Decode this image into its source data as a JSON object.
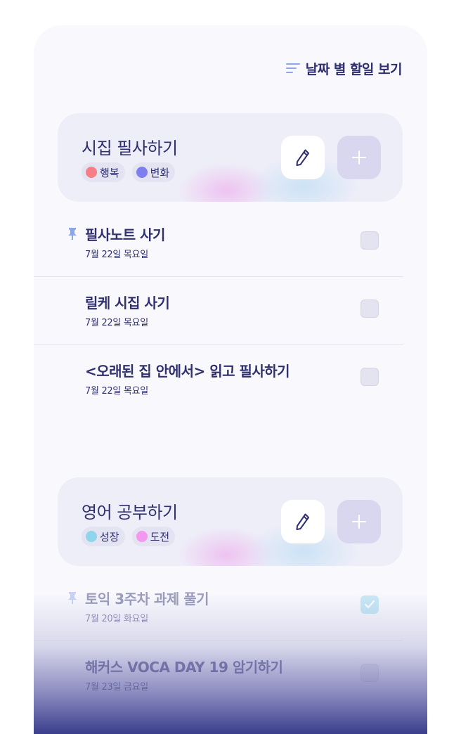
{
  "header": {
    "view_by_date_label": "날짜 별 할일 보기"
  },
  "groups": [
    {
      "title": "시집 필사하기",
      "tags": [
        {
          "label": "행복",
          "color": "#f47f86"
        },
        {
          "label": "변화",
          "color": "#7e7ef0"
        }
      ],
      "tasks": [
        {
          "title": "필사노트 사기",
          "date": "7월 22일 목요일",
          "pinned": true,
          "checked": false
        },
        {
          "title": "릴케 시집 사기",
          "date": "7월 22일 목요일",
          "pinned": false,
          "checked": false
        },
        {
          "title": "<오래된 집 안에서> 읽고 필사하기",
          "date": "7월 22일 목요일",
          "pinned": false,
          "checked": false
        }
      ]
    },
    {
      "title": "영어 공부하기",
      "tags": [
        {
          "label": "성장",
          "color": "#8fd6ec"
        },
        {
          "label": "도전",
          "color": "#f497f0"
        }
      ],
      "tasks": [
        {
          "title": "토익 3주차 과제 풀기",
          "date": "7월 20일 화요일",
          "pinned": true,
          "checked": true
        },
        {
          "title": "해커스 VOCA DAY 19 암기하기",
          "date": "7월 23일 금요일",
          "pinned": false,
          "checked": false
        }
      ]
    }
  ],
  "colors": {
    "accent": "#8fa6e6",
    "text": "#303070",
    "checked": "#8fd6ec",
    "pin": "#8fa6e6"
  }
}
